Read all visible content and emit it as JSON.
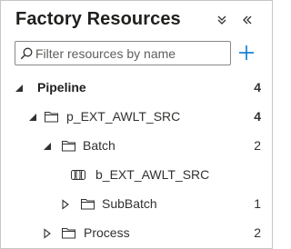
{
  "panel": {
    "title": "Factory Resources",
    "collapse_icon": "double-chevron-down-icon",
    "hide_icon": "double-chevron-left-icon"
  },
  "search": {
    "placeholder": "Filter resources by name",
    "value": "",
    "icon": "search-icon"
  },
  "add": {
    "icon": "plus-icon",
    "color": "#0078d4"
  },
  "tree": {
    "pipeline": {
      "label": "Pipeline",
      "count": "4",
      "expanded": true
    },
    "p_ext": {
      "label": "p_EXT_AWLT_SRC",
      "count": "4",
      "expanded": true
    },
    "batch": {
      "label": "Batch",
      "count": "2",
      "expanded": true
    },
    "b_ext": {
      "label": "b_EXT_AWLT_SRC",
      "icon": "pipeline-icon"
    },
    "subbatch": {
      "label": "SubBatch",
      "count": "1",
      "expanded": false
    },
    "process": {
      "label": "Process",
      "count": "2",
      "expanded": false
    }
  }
}
